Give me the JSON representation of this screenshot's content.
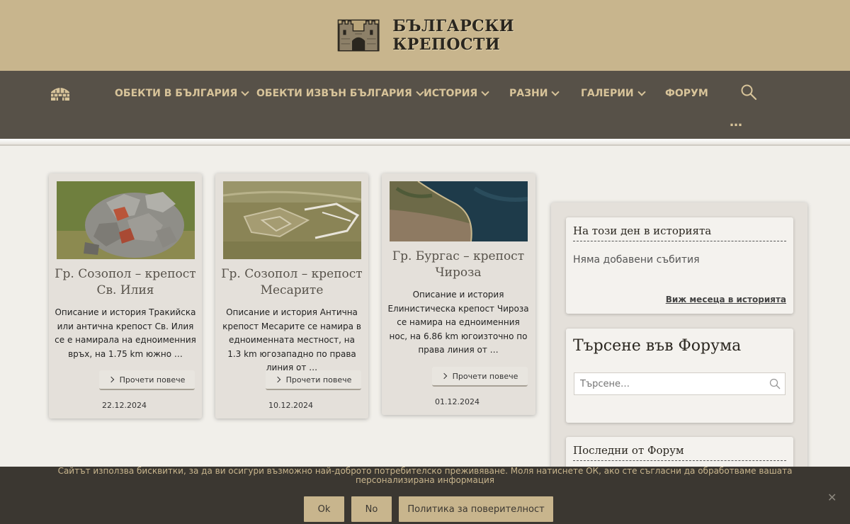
{
  "site": {
    "logo_line1": "БЪЛГАРСКИ",
    "logo_line2": "КРЕПОСТИ"
  },
  "nav": {
    "items": [
      {
        "label": "ОБЕКТИ В БЪЛГАРИЯ"
      },
      {
        "label": "ОБЕКТИ ИЗВЪН БЪЛГАРИЯ"
      },
      {
        "label": "ИСТОРИЯ"
      },
      {
        "label": "РАЗНИ"
      },
      {
        "label": "ГАЛЕРИИ"
      },
      {
        "label": "ФОРУМ"
      }
    ],
    "more": "…",
    "icons": {
      "home": "fortress-home-icon",
      "search": "search-icon"
    }
  },
  "posts": [
    {
      "title": "Гр. Созопол – крепост Св. Илия",
      "excerpt": "Описание и история Тракийска или антична крепост Св. Илия се е намирала на едноименния връх, на 1.75 km южно …",
      "read_more": "Прочети повече",
      "date": "22.12.2024"
    },
    {
      "title": "Гр. Созопол – крепост Месарите",
      "excerpt": "Описание и история Антична крепост Месарите се намира в едноименната местност, на 1.3 km югозападно по права линия от …",
      "read_more": "Прочети повече",
      "date": "10.12.2024"
    },
    {
      "title": "Гр. Бургас – крепост Чироза",
      "excerpt": "Описание и история Елинистическа крепост Чироза се намира на едноименния нос, на 6.86 km югоизточно по права линия от …",
      "read_more": "Прочети повече",
      "date": "01.12.2024"
    }
  ],
  "sidebar": {
    "history_day": {
      "title": "На този ден в историята",
      "empty_text": "Няма добавени събития",
      "month_link": "Виж месеца в историята"
    },
    "forum_search": {
      "title": "Търсене във Форума",
      "placeholder": "Търсене…"
    },
    "forum_latest": {
      "title": "Последни от Форум"
    }
  },
  "cookie": {
    "text": "Сайтът използва бисквитки, за да ви осигури възможно най-доброто потребителско преживяване. Моля натиснете ОК, ако сте съгласни да обработваме вашата персонализирана информация",
    "ok": "Ok",
    "no": "No",
    "privacy": "Политика за поверителност",
    "close": "✕"
  },
  "colors": {
    "header": "#c8b58d",
    "nav": "#575148",
    "nav_text": "#d8c49a",
    "cookie_bar": "#3b3731"
  }
}
